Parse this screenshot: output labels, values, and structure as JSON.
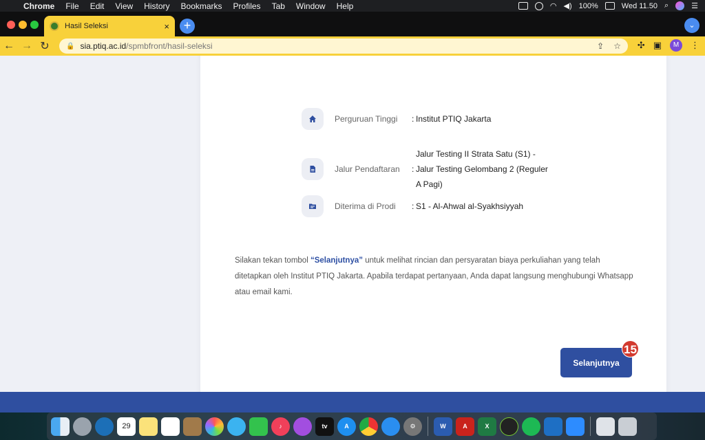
{
  "menubar": {
    "app_name": "Chrome",
    "items": [
      "File",
      "Edit",
      "View",
      "History",
      "Bookmarks",
      "Profiles",
      "Tab",
      "Window",
      "Help"
    ],
    "battery": "100%",
    "clock": "Wed 11.50"
  },
  "browser": {
    "tab_title": "Hasil Seleksi",
    "tab_close": "×",
    "new_tab": "+",
    "url_host": "sia.ptiq.ac.id",
    "url_path": "/spmbfront/hasil-seleksi",
    "profile_initial": "M"
  },
  "info": {
    "rows": [
      {
        "label": "Perguruan Tinggi",
        "colon": ":",
        "value": "Institut PTIQ Jakarta"
      },
      {
        "label": "Jalur Pendaftaran",
        "colon": ":",
        "value": "Jalur Testing II Strata Satu (S1) - Jalur Testing Gelombang 2 (Reguler A Pagi)"
      },
      {
        "label": "Diterima di Prodi",
        "colon": ":",
        "value": "S1 - Al-Ahwal al-Syakhsiyyah"
      }
    ]
  },
  "note": {
    "before": "Silakan tekan tombol ",
    "highlight": "“Selanjutnya”",
    "after": " untuk melihat rincian dan persyaratan biaya perkuliahan yang telah ditetapkan oleh Institut PTIQ Jakarta. Apabila terdapat pertanyaan, Anda dapat langsung menghubungi Whatsapp atau email kami."
  },
  "next_button": "Selanjutnya",
  "badge": "15",
  "colors": {
    "accent": "#2f4fa0",
    "chrome_theme": "#f8d13a",
    "badge": "#d23a2f"
  },
  "dock": {
    "icons": [
      "finder-icon",
      "launchpad-icon",
      "edge-icon",
      "calendar-icon",
      "notes-icon",
      "reminders-icon",
      "keynote-icon",
      "photos-icon",
      "messages-icon",
      "facetime-icon",
      "music-icon",
      "podcasts-icon",
      "apple-tv-icon",
      "app-store-icon",
      "chrome-icon",
      "safari-icon",
      "system-preferences-icon",
      "word-icon",
      "acrobat-icon",
      "excel-icon",
      "inkscape-icon",
      "spotify-icon",
      "vscode-icon",
      "zoom-icon",
      "preview-icon",
      "trash-icon"
    ],
    "calendar_day": "29",
    "tv_label": "tv"
  }
}
